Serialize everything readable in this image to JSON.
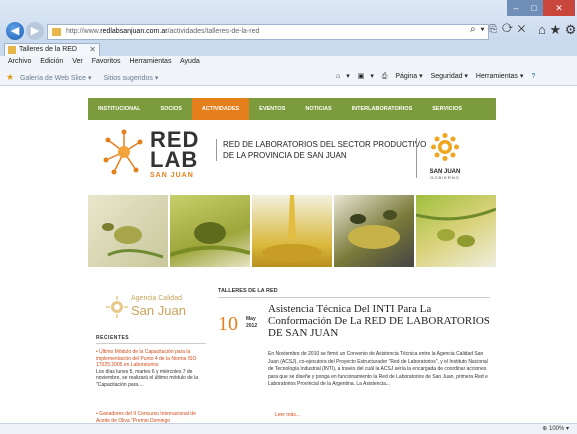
{
  "browser": {
    "url_prefix": "http://www.",
    "url_domain": "redlabsanjuan.com.ar",
    "url_path": "/actividades/talleres-de-la-red",
    "address_tools": "⌕ ▾ ⎘ ⟳ ✕",
    "tab_title": "Talleres de la RED",
    "tab_close": "✕",
    "menu": [
      "Archivo",
      "Edición",
      "Ver",
      "Favoritos",
      "Herramientas",
      "Ayuda"
    ],
    "favorites": {
      "gallery": "Galería de Web Slice ▾",
      "suggested": "Sitios sugeridos ▾"
    },
    "command_bar": [
      "▾",
      "▾",
      "Página ▾",
      "Seguridad ▾",
      "Herramientas ▾"
    ],
    "zoom": "⊕ 100% ▾"
  },
  "site": {
    "nav": [
      "INSTITUCIONAL",
      "SOCIOS",
      "ACTIVIDADES",
      "EVENTOS",
      "NOTICIAS",
      "INTERLABORATORIOS",
      "SERVICIOS"
    ],
    "active_nav": "ACTIVIDADES",
    "logo": {
      "line1": "RED",
      "line2": "LAB",
      "line3": "SAN JUAN"
    },
    "header_title": "RED DE LABORATORIOS DEL SECTOR PRODUCTIVO DE LA PROVINCIA DE SAN JUAN",
    "gov": {
      "name": "SAN JUAN",
      "sub": "GOBIERNO"
    },
    "agency": {
      "line1": "Agencia Calidad",
      "line2": "San Juan"
    },
    "recientes_label": "RECIENTES",
    "recent": [
      {
        "link": "• Último Módulo de la Capacitación para la implementación del Punto 4 de la Norma ISO 17025:2005 en Laboratorios",
        "text": "Los días lunes 5, martes 6 y miércoles 7 de noviembre, se realizará el último módulo de la \"Capacitación para...."
      },
      {
        "link": "• Ganadores del II Concurso Internacional de Aceite de Oliva \"Premio Domingo",
        "text": ""
      }
    ],
    "section_label": "TALLERES DE LA RED",
    "article": {
      "day": "10",
      "month": "May",
      "year": "2012",
      "title": "Asistencia Técnica Del INTI Para La Conformación De La RED DE LABORATORIOS DE SAN JUAN",
      "body": "En Noviembre de 2010 se firmó un Convenio de Asistencia Técnica entre la Agencia Calidad San Juan (ACSJ), co-ejecutora del Proyecto Estructurador \"Red de Laboratorios\", y el Instituto Nacional de Tecnología Industrial (INTI), a través del cuál la ACSJ sería la encargada de coordinar acciones para que se diseñe y ponga en funcionamiento la Red de Laboratorios de San Juan, primera Red e Laboratorios Provincial de la Argentina. La Asistencia...",
      "read_more": "Leer más..."
    }
  },
  "colors": {
    "nav_green": "#7c9b3c",
    "accent_orange": "#e57f1c",
    "link_red": "#d24b19"
  }
}
